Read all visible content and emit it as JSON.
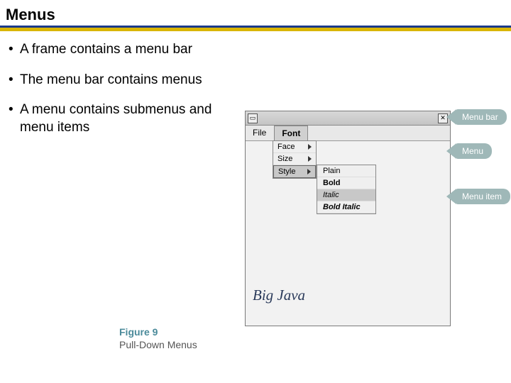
{
  "title": "Menus",
  "bullets": [
    "A frame contains a menu bar",
    "The menu bar contains menus",
    "A menu contains submenus and menu items"
  ],
  "window": {
    "menubar": {
      "items": [
        "File",
        "Font"
      ],
      "active": "Font"
    },
    "dropdown1": {
      "items": [
        "Face",
        "Size",
        "Style"
      ],
      "selected": "Style"
    },
    "dropdown2": {
      "items": [
        "Plain",
        "Bold",
        "Italic",
        "Bold Italic"
      ],
      "highlighted": "Italic"
    },
    "sample_text": "Big Java"
  },
  "callouts": {
    "menubar": "Menu bar",
    "menu": "Menu",
    "menuitem": "Menu item"
  },
  "caption": {
    "number": "Figure 9",
    "title": "Pull-Down Menus"
  }
}
